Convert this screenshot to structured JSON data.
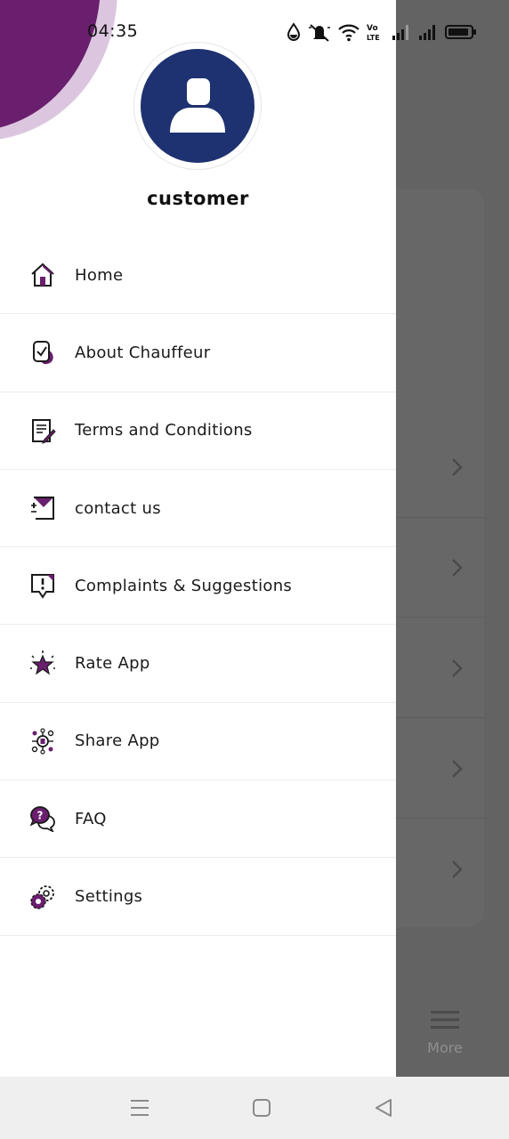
{
  "status_bar": {
    "time": "04:35",
    "icons": [
      "water-drop-icon",
      "mute-icon",
      "wifi-icon",
      "volte-icon",
      "signal-icon",
      "signal-icon",
      "battery-icon"
    ]
  },
  "profile": {
    "username": "customer",
    "avatar_icon": "user-avatar-icon"
  },
  "menu": {
    "items": [
      {
        "label": "Home",
        "icon": "home-icon"
      },
      {
        "label": "About Chauffeur",
        "icon": "about-icon"
      },
      {
        "label": "Terms and Conditions",
        "icon": "terms-icon"
      },
      {
        "label": "contact us",
        "icon": "contact-icon"
      },
      {
        "label": "Complaints & Suggestions",
        "icon": "complaint-icon"
      },
      {
        "label": "Rate App",
        "icon": "star-icon"
      },
      {
        "label": "Share App",
        "icon": "share-icon"
      },
      {
        "label": "FAQ",
        "icon": "faq-icon"
      },
      {
        "label": "Settings",
        "icon": "settings-icon"
      }
    ]
  },
  "background_app": {
    "more_label": "More"
  },
  "colors": {
    "brand_purple": "#6a1f6e",
    "avatar_blue": "#1e3170",
    "overlay_gray": "#636363"
  }
}
